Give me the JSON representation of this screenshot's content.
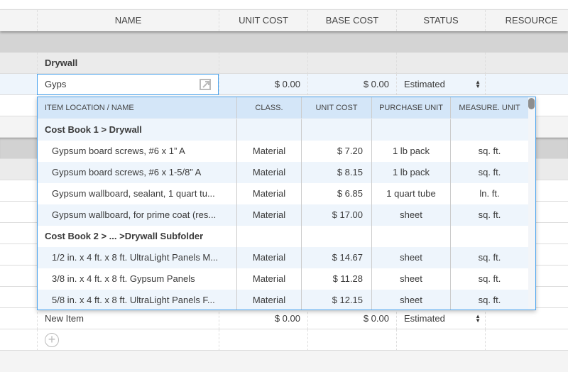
{
  "columns": [
    "NAME",
    "UNIT COST",
    "BASE COST",
    "STATUS",
    "RESOURCE"
  ],
  "section_title": "Drywall",
  "edit_row": {
    "name_value": "Gyps",
    "unit_cost": "$ 0.00",
    "base_cost": "$ 0.00",
    "status": "Estimated"
  },
  "new_item": {
    "name": "New Item",
    "unit_cost": "$ 0.00",
    "base_cost": "$ 0.00",
    "status": "Estimated"
  },
  "popup": {
    "columns": [
      "ITEM LOCATION / NAME",
      "CLASS.",
      "UNIT COST",
      "PURCHASE UNIT",
      "MEASURE. UNIT"
    ],
    "rows": [
      {
        "group": "Cost Book 1 > Drywall"
      },
      {
        "name": "Gypsum board screws, #6 x 1” A",
        "class": "Material",
        "cost": "$ 7.20",
        "purchase": "1 lb pack",
        "measure": "sq. ft."
      },
      {
        "name": "Gypsum board screws, #6 x 1-5/8” A",
        "class": "Material",
        "cost": "$ 8.15",
        "purchase": "1 lb pack",
        "measure": "sq. ft."
      },
      {
        "name": "Gypsum wallboard, sealant, 1 quart tu...",
        "class": "Material",
        "cost": "$ 6.85",
        "purchase": "1 quart tube",
        "measure": "ln. ft."
      },
      {
        "name": "Gypsum wallboard, for prime coat (res...",
        "class": "Material",
        "cost": "$ 17.00",
        "purchase": "sheet",
        "measure": "sq. ft."
      },
      {
        "group": "Cost Book 2 > ... >Drywall Subfolder"
      },
      {
        "name": "1/2 in. x 4 ft. x 8 ft. UltraLight Panels M...",
        "class": "Material",
        "cost": "$ 14.67",
        "purchase": "sheet",
        "measure": "sq. ft."
      },
      {
        "name": "3/8 in. x 4 ft. x 8 ft. Gypsum Panels",
        "class": "Material",
        "cost": "$ 11.28",
        "purchase": "sheet",
        "measure": "sq. ft."
      },
      {
        "name": "5/8 in. x 4 ft. x 8 ft. UltraLight Panels F...",
        "class": "Material",
        "cost": "$ 12.15",
        "purchase": "sheet",
        "measure": "sq. ft."
      }
    ]
  }
}
